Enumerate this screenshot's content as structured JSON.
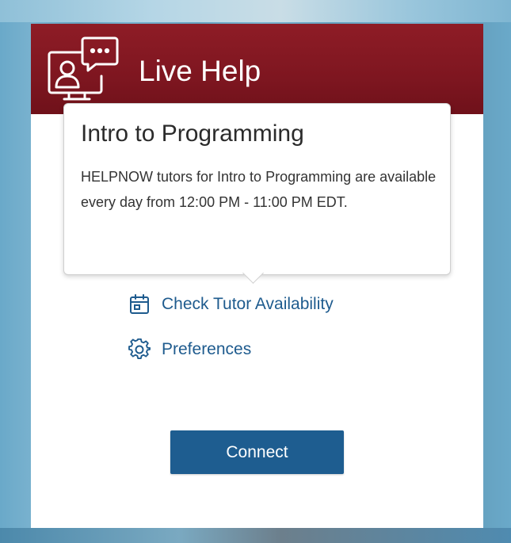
{
  "header": {
    "title": "Live Help",
    "icon": "chat-support-icon",
    "color": "#8e1c26"
  },
  "tooltip": {
    "title": "Intro to Programming",
    "body": "HELPNOW tutors for Intro to Programming are available every day from 12:00 PM - 11:00 PM EDT."
  },
  "links": {
    "availability": {
      "label": "Check Tutor Availability",
      "icon": "calendar-icon"
    },
    "preferences": {
      "label": "Preferences",
      "icon": "gear-icon"
    }
  },
  "actions": {
    "connect_label": "Connect",
    "accent": "#1e5d90"
  }
}
